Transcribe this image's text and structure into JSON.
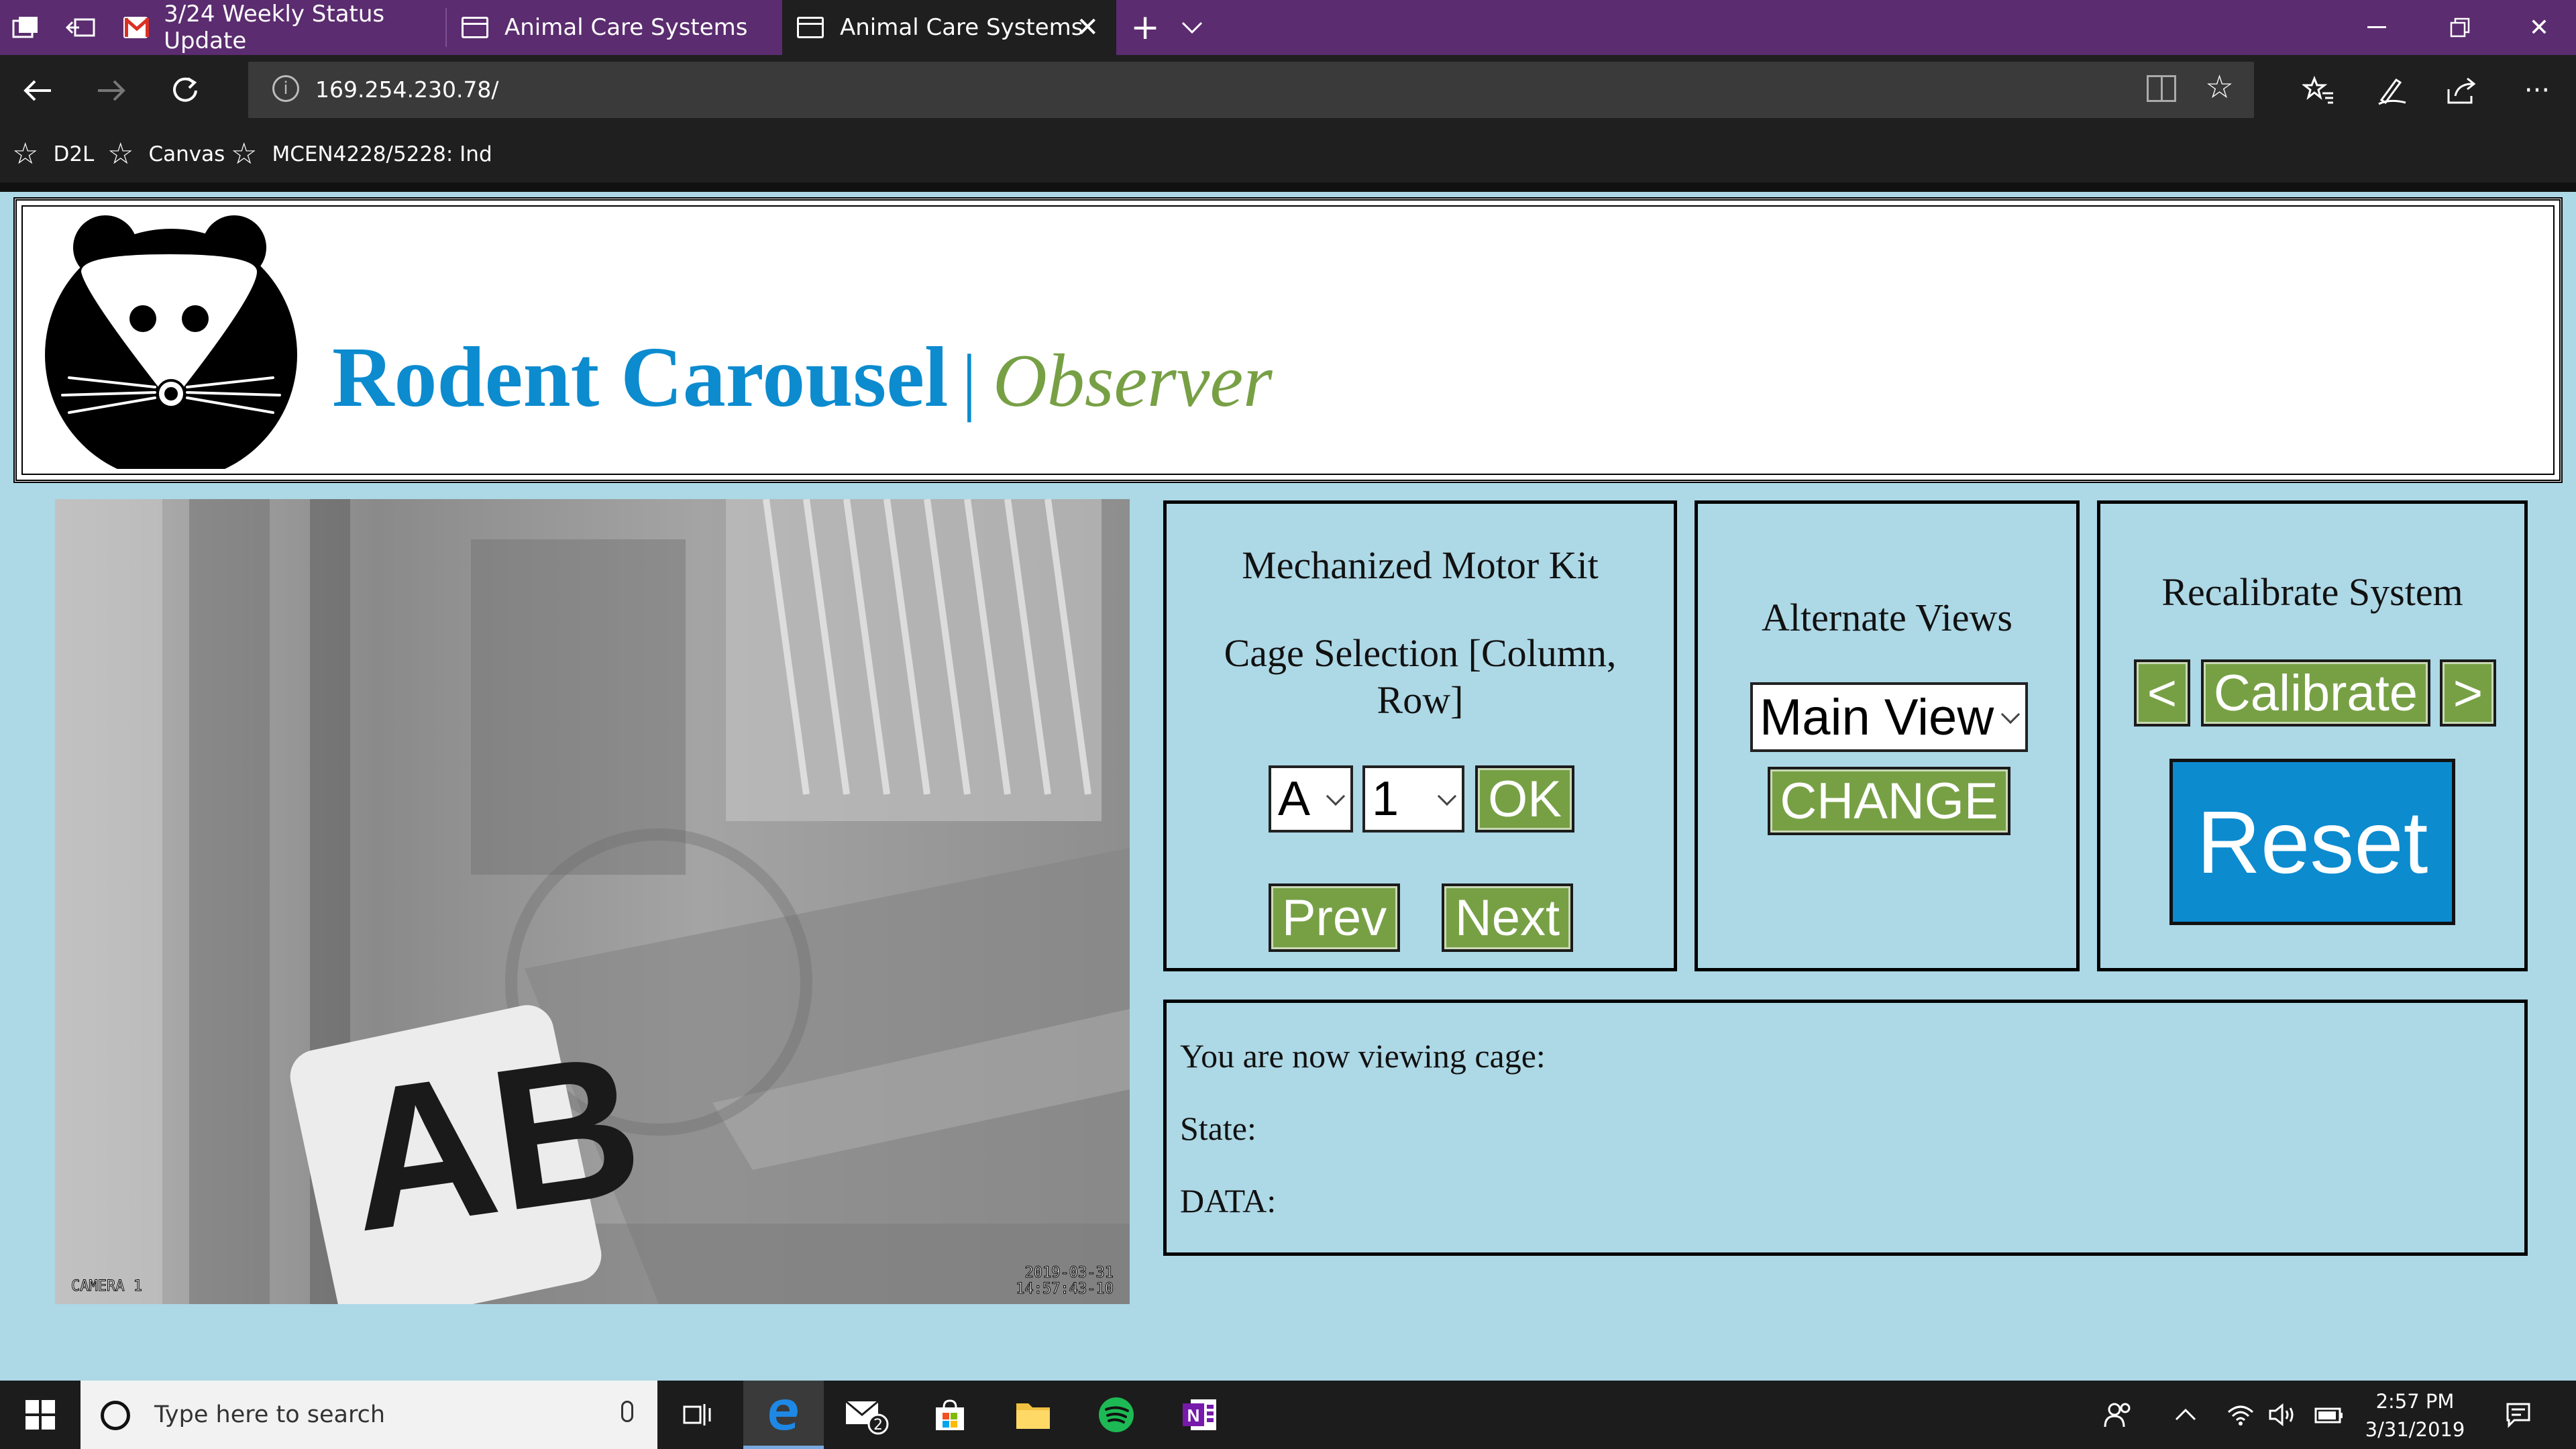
{
  "browser": {
    "tabs": [
      {
        "label": "3/24 Weekly Status Update"
      },
      {
        "label": "Animal Care Systems"
      },
      {
        "label": "Animal Care Systems"
      }
    ],
    "url": "169.254.230.78/",
    "favorites": [
      "D2L",
      "Canvas",
      "MCEN4228/5228: Ind"
    ]
  },
  "header": {
    "title_main": "Rodent Carousel",
    "separator": "|",
    "title_sub": "Observer"
  },
  "camera": {
    "label": "CAMERA 1",
    "date": "2019-03-31",
    "time": "14:57:43-10",
    "cage_tag": "AB"
  },
  "motor_panel": {
    "title": "Mechanized Motor Kit",
    "selection_label": "Cage Selection [Column, Row]",
    "column_value": "A",
    "row_value": "1",
    "ok_label": "OK",
    "prev_label": "Prev",
    "next_label": "Next"
  },
  "views_panel": {
    "title": "Alternate Views",
    "view_value": "Main View",
    "change_label": "CHANGE"
  },
  "calibrate_panel": {
    "title": "Recalibrate System",
    "left_label": "<",
    "calibrate_label": "Calibrate",
    "right_label": ">",
    "reset_label": "Reset"
  },
  "info_panel": {
    "cage_label": "You are now viewing cage:",
    "state_label": "State:",
    "data_label": "DATA:"
  },
  "taskbar": {
    "search_placeholder": "Type here to search",
    "mail_badge": "2",
    "time": "2:57 PM",
    "date": "3/31/2019"
  },
  "colors": {
    "page_bg": "#add8e6",
    "title_blue": "#0c8bcf",
    "observer_green": "#77a045",
    "button_green": "#77a045",
    "reset_blue": "#0c8bcf",
    "titlebar_purple": "#5b2c6f"
  }
}
